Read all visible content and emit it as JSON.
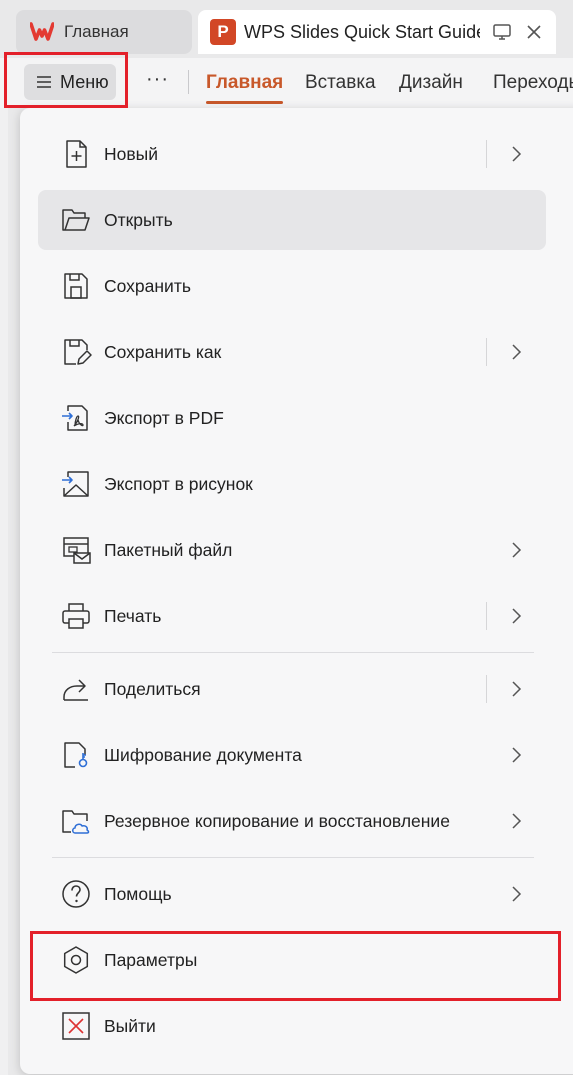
{
  "tabs": {
    "home_label": "Главная",
    "doc_label": "WPS Slides Quick Start Guide.p",
    "doc_icon_letter": "P",
    "logo_text": "W"
  },
  "ribbon": {
    "menu_label": "Меню",
    "more_label": "···",
    "tabs": [
      "Главная",
      "Вставка",
      "Дизайн",
      "Переходы"
    ],
    "active_tab": "Главная"
  },
  "menu": {
    "items": [
      {
        "label": "Новый",
        "icon": "new-file-icon",
        "submenu": true,
        "split": true
      },
      {
        "label": "Открыть",
        "icon": "folder-open-icon",
        "submenu": false,
        "split": false
      },
      {
        "label": "Сохранить",
        "icon": "save-icon",
        "submenu": false,
        "split": false
      },
      {
        "label": "Сохранить как",
        "icon": "save-as-icon",
        "submenu": true,
        "split": true
      },
      {
        "label": "Экспорт в PDF",
        "icon": "export-pdf-icon",
        "submenu": false,
        "split": false
      },
      {
        "label": "Экспорт в рисунок",
        "icon": "export-image-icon",
        "submenu": false,
        "split": false
      },
      {
        "label": "Пакетный файл",
        "icon": "batch-file-icon",
        "submenu": true,
        "split": false
      },
      {
        "label": "Печать",
        "icon": "print-icon",
        "submenu": true,
        "split": true
      },
      {
        "label": "Поделиться",
        "icon": "share-icon",
        "submenu": true,
        "split": true
      },
      {
        "label": "Шифрование документа",
        "icon": "encrypt-document-icon",
        "submenu": true,
        "split": false
      },
      {
        "label": "Резервное копирование и восстановление",
        "icon": "backup-restore-icon",
        "submenu": true,
        "split": false
      },
      {
        "label": "Помощь",
        "icon": "help-icon",
        "submenu": true,
        "split": false
      },
      {
        "label": "Параметры",
        "icon": "settings-icon",
        "submenu": false,
        "split": false
      },
      {
        "label": "Выйти",
        "icon": "exit-icon",
        "submenu": false,
        "split": false
      }
    ]
  },
  "colors": {
    "accent": "#c8582a",
    "highlight_box": "#e3202a",
    "wps_red": "#e33a32",
    "ppt_orange": "#d24726"
  }
}
